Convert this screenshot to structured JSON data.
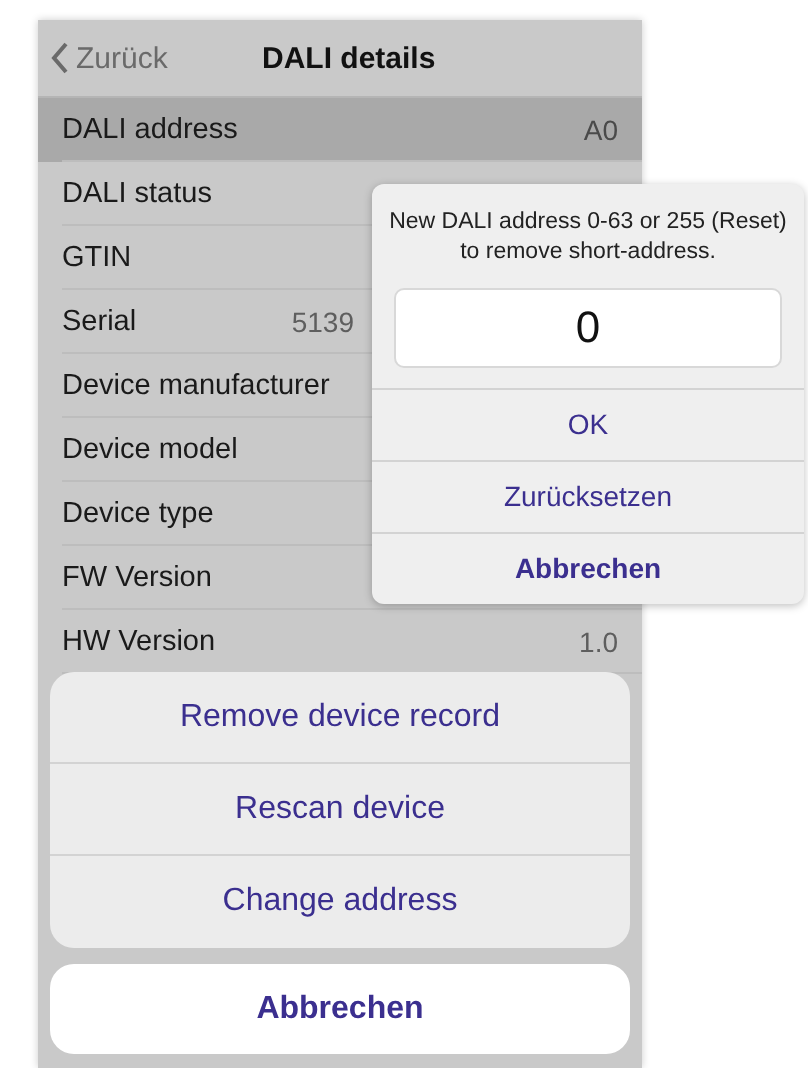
{
  "nav": {
    "back": "Zurück",
    "title": "DALI details"
  },
  "rows": [
    {
      "label": "DALI address",
      "value": "A0",
      "selected": true
    },
    {
      "label": "DALI status",
      "selected": false
    },
    {
      "label": "GTIN",
      "selected": false
    },
    {
      "label": "Serial",
      "value": "5139",
      "selected": false
    },
    {
      "label": "Device manufacturer",
      "selected": false
    },
    {
      "label": "Device model",
      "selected": false
    },
    {
      "label": "Device type",
      "selected": false
    },
    {
      "label": "FW Version",
      "selected": false
    },
    {
      "label": "HW Version",
      "value": "1.0",
      "selected": false
    }
  ],
  "action_sheet": {
    "actions": [
      "Remove device record",
      "Rescan device",
      "Change address"
    ],
    "cancel": "Abbrechen"
  },
  "dialog": {
    "message": "New DALI address 0-63 or 255 (Reset) to remove short-address.",
    "value": "0",
    "buttons": [
      {
        "label": "OK",
        "kind": "default"
      },
      {
        "label": "Zurücksetzen",
        "kind": "default"
      },
      {
        "label": "Abbrechen",
        "kind": "cancel"
      }
    ]
  }
}
